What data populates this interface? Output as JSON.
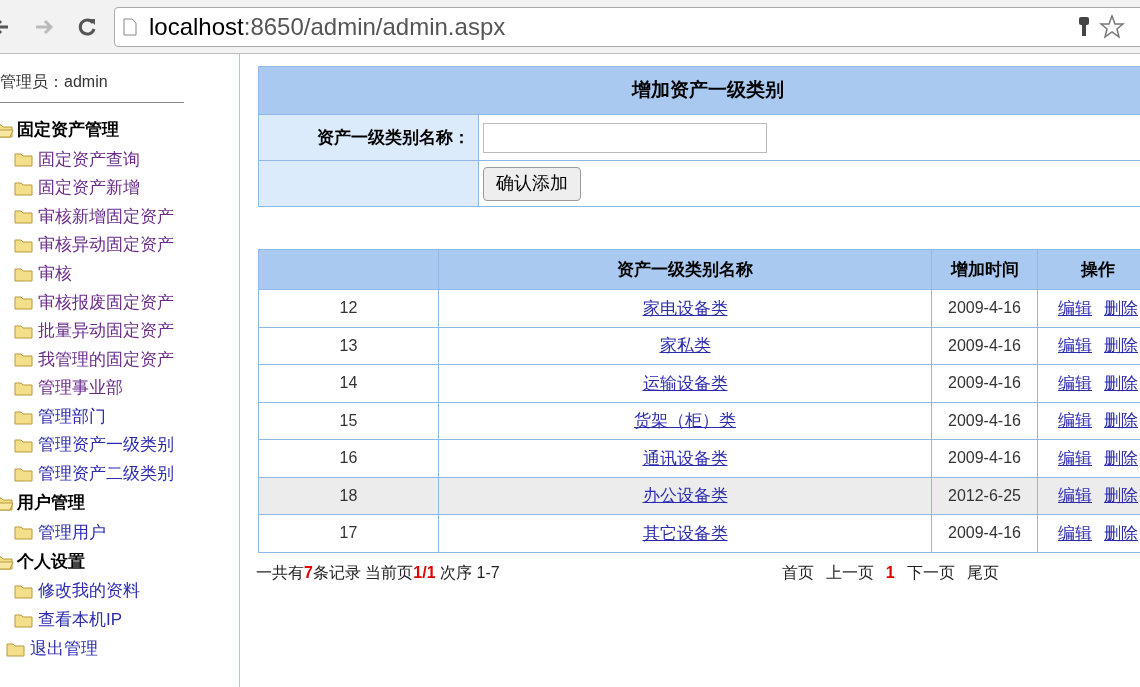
{
  "browser": {
    "url_host": "localhost",
    "url_rest": ":8650/admin/admin.aspx"
  },
  "sidebar": {
    "user": "管理员：admin",
    "groups": [
      {
        "title": "固定资产管理",
        "items": [
          {
            "label": "固定资产查询",
            "visited": true
          },
          {
            "label": "固定资产新增",
            "visited": true
          },
          {
            "label": "审核新增固定资产",
            "visited": true
          },
          {
            "label": "审核异动固定资产",
            "visited": true
          },
          {
            "label": "审核",
            "visited": true
          },
          {
            "label": "审核报废固定资产",
            "visited": true
          },
          {
            "label": "批量异动固定资产",
            "visited": true
          },
          {
            "label": "我管理的固定资产",
            "visited": true
          },
          {
            "label": "管理事业部",
            "visited": true
          },
          {
            "label": "管理部门",
            "visited": false
          },
          {
            "label": "管理资产一级类别",
            "visited": false
          },
          {
            "label": "管理资产二级类别",
            "visited": false
          }
        ]
      },
      {
        "title": "用户管理",
        "items": [
          {
            "label": "管理用户",
            "visited": false
          }
        ]
      },
      {
        "title": "个人设置",
        "items": [
          {
            "label": "修改我的资料",
            "visited": false
          },
          {
            "label": "查看本机IP",
            "visited": false
          }
        ]
      }
    ],
    "logout": "退出管理"
  },
  "form": {
    "title": "增加资产一级类别",
    "field_label": "资产一级类别名称：",
    "submit": "确认添加"
  },
  "table": {
    "columns": [
      "",
      "资产一级类别名称",
      "增加时间",
      "操作"
    ],
    "rows": [
      {
        "id": "12",
        "name": "家电设备类",
        "date": "2009-4-16",
        "edit": "编辑",
        "delete": "删除",
        "highlighted": false
      },
      {
        "id": "13",
        "name": "家私类",
        "date": "2009-4-16",
        "edit": "编辑",
        "delete": "删除",
        "highlighted": false
      },
      {
        "id": "14",
        "name": "运输设备类",
        "date": "2009-4-16",
        "edit": "编辑",
        "delete": "删除",
        "highlighted": false
      },
      {
        "id": "15",
        "name": "货架（柜）类",
        "date": "2009-4-16",
        "edit": "编辑",
        "delete": "删除",
        "highlighted": false
      },
      {
        "id": "16",
        "name": "通讯设备类",
        "date": "2009-4-16",
        "edit": "编辑",
        "delete": "删除",
        "highlighted": false
      },
      {
        "id": "18",
        "name": "办公设备类",
        "date": "2012-6-25",
        "edit": "编辑",
        "delete": "删除",
        "highlighted": true
      },
      {
        "id": "17",
        "name": "其它设备类",
        "date": "2009-4-16",
        "edit": "编辑",
        "delete": "删除",
        "highlighted": false
      }
    ]
  },
  "pager": {
    "summary": "一共有**7**条记录 当前页**1/1** 次序 1-7",
    "links": [
      {
        "label": "首页",
        "selected": false
      },
      {
        "label": "上一页",
        "selected": false
      },
      {
        "label": "1",
        "selected": true
      },
      {
        "label": "下一页",
        "selected": false
      },
      {
        "label": "尾页",
        "selected": false
      }
    ]
  }
}
